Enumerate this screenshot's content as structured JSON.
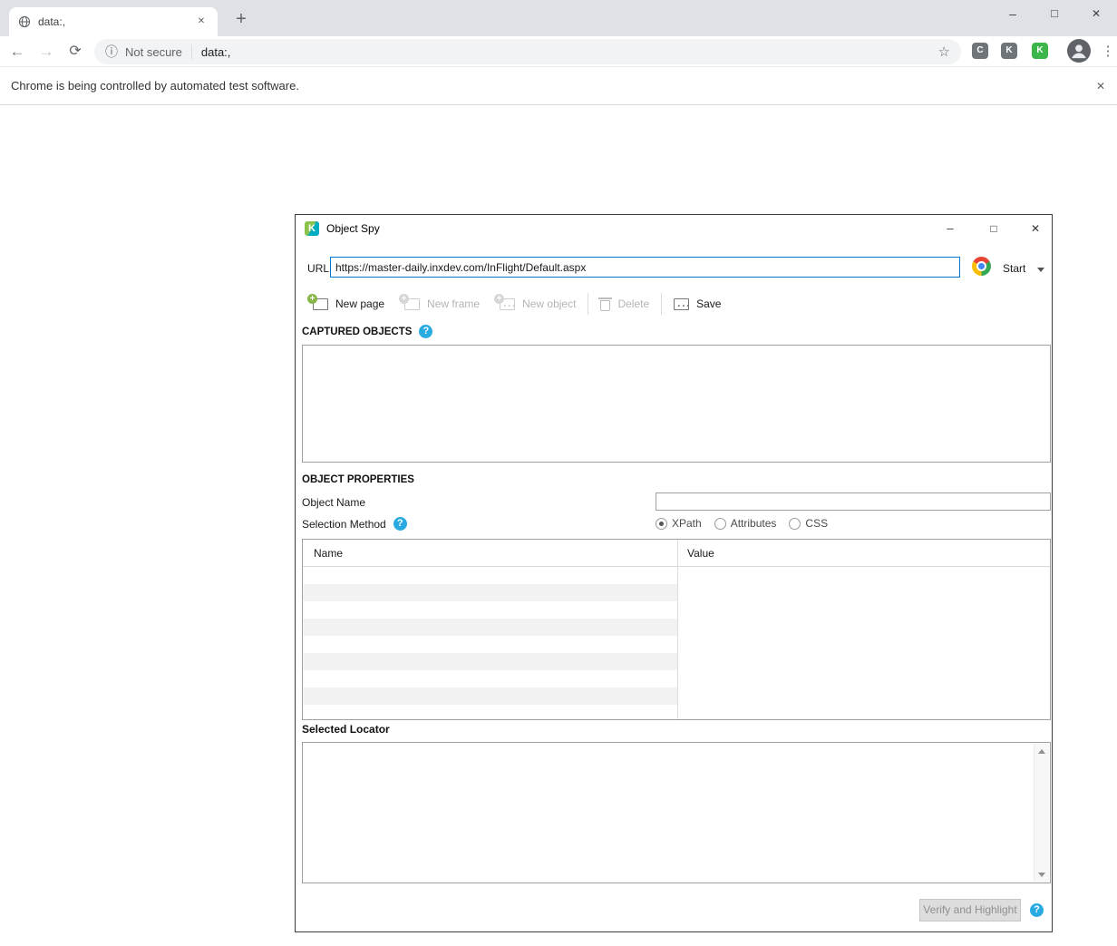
{
  "browser": {
    "tab_title": "data:,",
    "omnibox": {
      "security_label": "Not secure",
      "url": "data:,"
    },
    "infobar_text": "Chrome is being controlled by automated test software.",
    "extensions": [
      {
        "label": "C"
      },
      {
        "label": "K"
      }
    ]
  },
  "dialog": {
    "title": "Object Spy",
    "url": {
      "label": "URL",
      "value": "https://master-daily.inxdev.com/InFlight/Default.aspx"
    },
    "start_label": "Start",
    "toolbar": {
      "new_page": "New page",
      "new_frame": "New frame",
      "new_object": "New object",
      "delete": "Delete",
      "save": "Save"
    },
    "captured_objects_heading": "CAPTURED OBJECTS",
    "object_properties_heading": "OBJECT PROPERTIES",
    "object_name_label": "Object Name",
    "selection_method_label": "Selection Method",
    "selection_methods": [
      {
        "label": "XPath",
        "selected": true
      },
      {
        "label": "Attributes",
        "selected": false
      },
      {
        "label": "CSS",
        "selected": false
      }
    ],
    "properties_table": {
      "columns": [
        "Name",
        "Value"
      ]
    },
    "selected_locator_heading": "Selected Locator",
    "verify_button_label": "Verify and Highlight",
    "colors": {
      "accent_blue": "#29abe2",
      "focus_border": "#0078d7",
      "katalon_green": "#8bc34a"
    }
  }
}
